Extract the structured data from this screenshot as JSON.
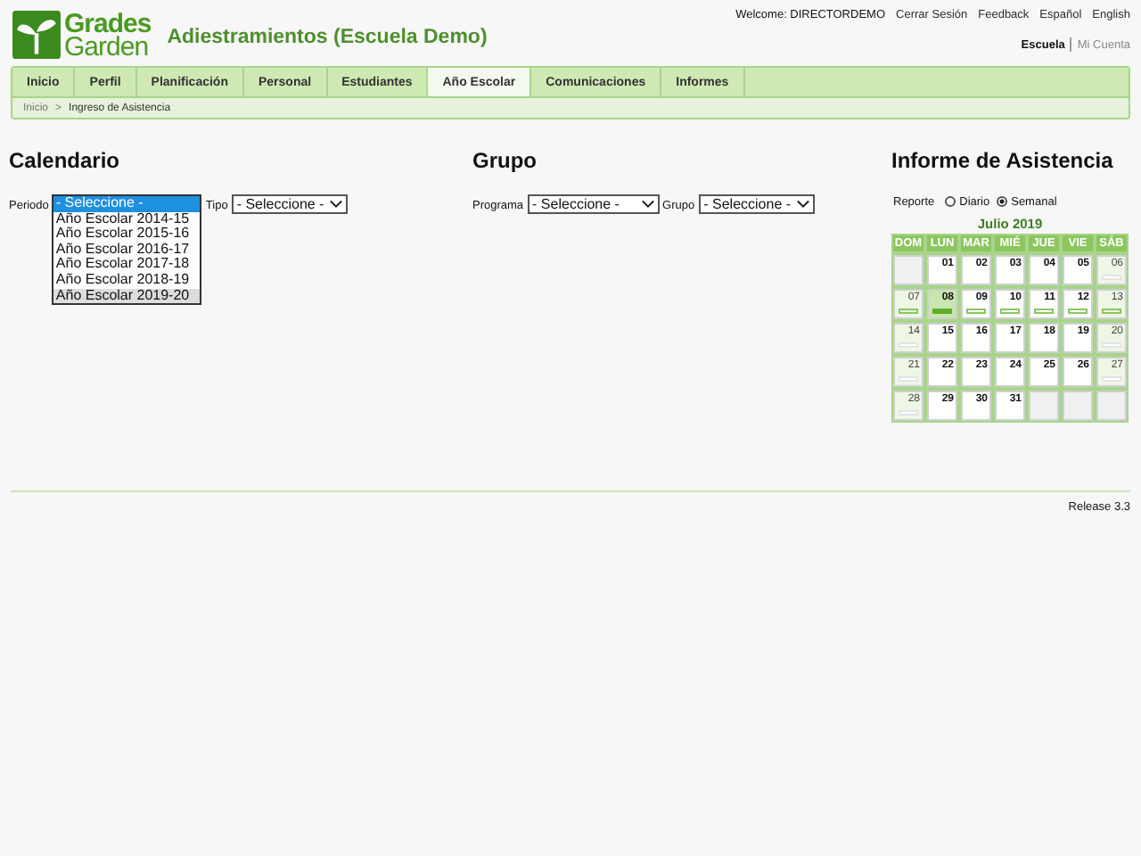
{
  "logo": {
    "line_1": "Grades",
    "line_2": "Garden"
  },
  "site_title": "Adiestramientos (Escuela Demo)",
  "top_links": [
    {
      "label": "Welcome: DIRECTORDEMO",
      "kind": "text"
    },
    {
      "label": "Cerrar Sesión",
      "kind": "link"
    },
    {
      "label": "Feedback",
      "kind": "link"
    },
    {
      "label": "Español",
      "kind": "link"
    },
    {
      "label": "English",
      "kind": "link"
    }
  ],
  "account_links": [
    {
      "label": "Escuela",
      "selected": true
    },
    {
      "label": "Mi Cuenta",
      "selected": false
    }
  ],
  "nav_tabs": [
    {
      "label": "Inicio",
      "selected": false
    },
    {
      "label": "Perfil",
      "selected": false
    },
    {
      "label": "Planificación",
      "selected": false
    },
    {
      "label": "Personal",
      "selected": false
    },
    {
      "label": "Estudiantes",
      "selected": false
    },
    {
      "label": "Año Escolar",
      "selected": true
    },
    {
      "label": "Comunicaciones",
      "selected": false
    },
    {
      "label": "Informes",
      "selected": false
    }
  ],
  "breadcrumb": [
    {
      "label": "Inicio"
    },
    {
      "label": "Ingreso de Asistencia"
    }
  ],
  "breadcrumb_separator": ">",
  "calendario": {
    "title": "Calendario",
    "periodo_label": "Periodo",
    "periodo_options": [
      {
        "label": "- Seleccione -",
        "selected": true,
        "hovered": false
      },
      {
        "label": "Año Escolar 2014-15",
        "selected": false,
        "hovered": false
      },
      {
        "label": "Año Escolar 2015-16",
        "selected": false,
        "hovered": false
      },
      {
        "label": "Año Escolar 2016-17",
        "selected": false,
        "hovered": false
      },
      {
        "label": "Año Escolar 2017-18",
        "selected": false,
        "hovered": false
      },
      {
        "label": "Año Escolar 2018-19",
        "selected": false,
        "hovered": false
      },
      {
        "label": "Año Escolar 2019-20",
        "selected": false,
        "hovered": true
      }
    ],
    "tipo_label": "Tipo",
    "tipo_value": "- Seleccione -"
  },
  "grupo": {
    "title": "Grupo",
    "programa_label": "Programa",
    "programa_value": "- Seleccione -",
    "grupo_label": "Grupo",
    "grupo_value": "- Seleccione -"
  },
  "informe": {
    "title": "Informe de Asistencia",
    "reporte_label": "Reporte",
    "options": [
      {
        "label": "Diario",
        "selected": false
      },
      {
        "label": "Semanal",
        "selected": true
      }
    ],
    "month": "Julio 2019",
    "weekdays": [
      "DOM",
      "LUN",
      "MAR",
      "MIÉ",
      "JUE",
      "VIE",
      "SÁB"
    ],
    "weeks": [
      [
        {
          "kind": "empty"
        },
        {
          "kind": "weekday",
          "day": "01",
          "selected": false
        },
        {
          "kind": "weekday",
          "day": "02",
          "selected": false
        },
        {
          "kind": "weekday",
          "day": "03",
          "selected": false
        },
        {
          "kind": "weekday",
          "day": "04",
          "selected": false
        },
        {
          "kind": "weekday",
          "day": "05",
          "selected": false
        },
        {
          "kind": "weekend",
          "day": "06",
          "bar": {
            "kind": "plain"
          },
          "selected": false
        }
      ],
      [
        {
          "kind": "weekend",
          "day": "07",
          "bar": {
            "kind": "outline"
          },
          "selected": false
        },
        {
          "kind": "weekday",
          "day": "08",
          "bar": {
            "kind": "filled"
          },
          "selected": true
        },
        {
          "kind": "weekday",
          "day": "09",
          "bar": {
            "kind": "outline"
          },
          "selected": false
        },
        {
          "kind": "weekday",
          "day": "10",
          "bar": {
            "kind": "outline"
          },
          "selected": false
        },
        {
          "kind": "weekday",
          "day": "11",
          "bar": {
            "kind": "outline"
          },
          "selected": false
        },
        {
          "kind": "weekday",
          "day": "12",
          "bar": {
            "kind": "outline"
          },
          "selected": false
        },
        {
          "kind": "weekend",
          "day": "13",
          "bar": {
            "kind": "outline"
          },
          "selected": false
        }
      ],
      [
        {
          "kind": "weekend",
          "day": "14",
          "bar": {
            "kind": "plain"
          },
          "selected": false
        },
        {
          "kind": "weekday",
          "day": "15",
          "selected": false
        },
        {
          "kind": "weekday",
          "day": "16",
          "selected": false
        },
        {
          "kind": "weekday",
          "day": "17",
          "selected": false
        },
        {
          "kind": "weekday",
          "day": "18",
          "selected": false
        },
        {
          "kind": "weekday",
          "day": "19",
          "selected": false
        },
        {
          "kind": "weekend",
          "day": "20",
          "bar": {
            "kind": "plain"
          },
          "selected": false
        }
      ],
      [
        {
          "kind": "weekend",
          "day": "21",
          "bar": {
            "kind": "plain"
          },
          "selected": false
        },
        {
          "kind": "weekday",
          "day": "22",
          "selected": false
        },
        {
          "kind": "weekday",
          "day": "23",
          "selected": false
        },
        {
          "kind": "weekday",
          "day": "24",
          "selected": false
        },
        {
          "kind": "weekday",
          "day": "25",
          "selected": false
        },
        {
          "kind": "weekday",
          "day": "26",
          "selected": false
        },
        {
          "kind": "weekend",
          "day": "27",
          "bar": {
            "kind": "plain"
          },
          "selected": false
        }
      ],
      [
        {
          "kind": "weekend",
          "day": "28",
          "bar": {
            "kind": "plain"
          },
          "selected": false
        },
        {
          "kind": "weekday",
          "day": "29",
          "selected": false
        },
        {
          "kind": "weekday",
          "day": "30",
          "selected": false
        },
        {
          "kind": "weekday",
          "day": "31",
          "selected": false
        },
        {
          "kind": "empty"
        },
        {
          "kind": "empty"
        },
        {
          "kind": "empty"
        }
      ]
    ]
  },
  "release": "Release 3.3"
}
